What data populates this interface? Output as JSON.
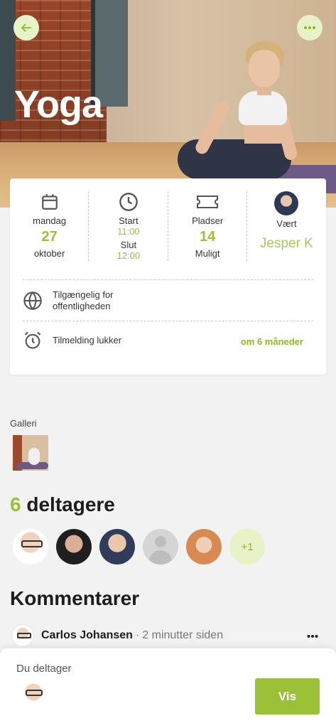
{
  "hero": {
    "title": "Yoga",
    "back_icon": "arrow-left-icon",
    "more_icon": "more-horizontal-icon"
  },
  "event_info": {
    "date": {
      "weekday": "mandag",
      "day": "27",
      "month": "oktober",
      "icon": "calendar-icon"
    },
    "time": {
      "start_label": "Start",
      "start_value": "11:00",
      "end_label": "Slut",
      "end_value": "12:00",
      "icon": "clock-icon"
    },
    "seats": {
      "label": "Pladser",
      "value": "14",
      "sub": "Muligt",
      "icon": "ticket-icon"
    },
    "host": {
      "label": "Vært",
      "name": "Jesper K"
    },
    "visibility": {
      "text": "Tilgængelig for offentligheden",
      "icon": "globe-icon"
    },
    "registration": {
      "text": "Tilmelding lukker",
      "value": "om 6 måneder",
      "icon": "alarm-clock-icon"
    }
  },
  "gallery": {
    "label": "Galleri"
  },
  "participants": {
    "count": "6",
    "label": "deltagere",
    "more": "+1"
  },
  "comments": {
    "title": "Kommentarer",
    "items": [
      {
        "author": "Carlos Johansen",
        "separator": "·",
        "time": "2 minutter siden"
      }
    ]
  },
  "bottom": {
    "label": "Du deltager",
    "button": "Vis"
  },
  "colors": {
    "accent": "#9bc139",
    "accent_light": "#e8f2c9",
    "background": "#f2f2f2"
  }
}
